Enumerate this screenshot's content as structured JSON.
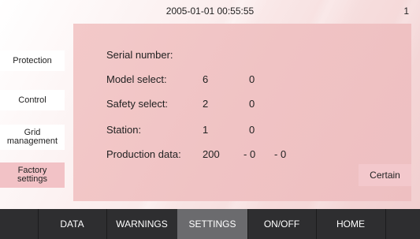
{
  "header": {
    "datetime": "2005-01-01  00:55:55",
    "page_number": "1"
  },
  "sidebar": {
    "items": [
      {
        "label": "Protection"
      },
      {
        "label": "Control"
      },
      {
        "label": "Grid\nmanagement"
      },
      {
        "label": "Factory\nsettings",
        "active": true
      }
    ]
  },
  "form": {
    "serial_label": "Serial number:",
    "model_label": "Model select:",
    "model_value_1": "6",
    "model_value_2": "0",
    "safety_label": "Safety select:",
    "safety_value_1": "2",
    "safety_value_2": "0",
    "station_label": "Station:",
    "station_value_1": "1",
    "station_value_2": "0",
    "production_label": "Production data:",
    "production_year": "200",
    "production_month": "- 0",
    "production_day": "- 0"
  },
  "certain_label": "Certain",
  "nav": {
    "items": [
      {
        "label": ""
      },
      {
        "label": "DATA"
      },
      {
        "label": "WARNINGS"
      },
      {
        "label": "SETTINGS",
        "active": true
      },
      {
        "label": "ON/OFF"
      },
      {
        "label": "HOME"
      },
      {
        "label": ""
      }
    ]
  },
  "colors": {
    "panel": "#f0c3c4",
    "active_side": "#f2c2c6",
    "nav_bg": "#2e2e30",
    "nav_active": "#6b6b6e"
  }
}
